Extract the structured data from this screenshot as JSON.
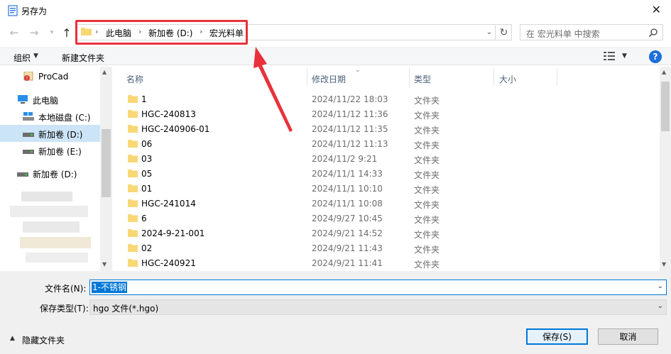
{
  "window": {
    "title": "另存为",
    "close_glyph": "✕"
  },
  "address": {
    "crumbs": [
      "此电脑",
      "新加卷 (D:)",
      "宏光料单"
    ],
    "separator": "›"
  },
  "search": {
    "placeholder": "在 宏光料单 中搜索"
  },
  "toolbar": {
    "organize": "组织",
    "new_folder": "新建文件夹",
    "help": "?"
  },
  "nav_pane": {
    "items": [
      {
        "label": "ProCad",
        "icon": "procad-icon"
      },
      {
        "label": "此电脑",
        "icon": "computer-icon"
      },
      {
        "label": "本地磁盘 (C:)",
        "icon": "drive-c-icon"
      },
      {
        "label": "新加卷 (D:)",
        "icon": "drive-icon",
        "selected": true
      },
      {
        "label": "新加卷 (E:)",
        "icon": "drive-icon"
      },
      {
        "label": "新加卷 (D:)",
        "icon": "network-drive-icon"
      }
    ]
  },
  "columns": {
    "name": "名称",
    "date": "修改日期",
    "type": "类型",
    "size": "大小"
  },
  "files": [
    {
      "name": "1",
      "date": "2024/11/22 18:03",
      "type": "文件夹"
    },
    {
      "name": "HGC-240813",
      "date": "2024/11/12 11:36",
      "type": "文件夹"
    },
    {
      "name": "HGC-240906-01",
      "date": "2024/11/12 11:35",
      "type": "文件夹"
    },
    {
      "name": "06",
      "date": "2024/11/12 11:13",
      "type": "文件夹"
    },
    {
      "name": "03",
      "date": "2024/11/2 9:21",
      "type": "文件夹"
    },
    {
      "name": "05",
      "date": "2024/11/1 14:33",
      "type": "文件夹"
    },
    {
      "name": "01",
      "date": "2024/11/1 10:10",
      "type": "文件夹"
    },
    {
      "name": "HGC-241014",
      "date": "2024/11/1 10:08",
      "type": "文件夹"
    },
    {
      "name": "6",
      "date": "2024/9/27 10:45",
      "type": "文件夹"
    },
    {
      "name": "2024-9-21-001",
      "date": "2024/9/21 14:52",
      "type": "文件夹"
    },
    {
      "name": "02",
      "date": "2024/9/21 11:43",
      "type": "文件夹"
    },
    {
      "name": "HGC-240921",
      "date": "2024/9/21 11:41",
      "type": "文件夹"
    }
  ],
  "filename": {
    "label": "文件名(N):",
    "value": "1-不锈钢"
  },
  "save_type": {
    "label": "保存类型(T):",
    "value": "hgo 文件(*.hgo)"
  },
  "footer": {
    "hide_folders": "隐藏文件夹",
    "save": "保存(S)",
    "cancel": "取消"
  },
  "colors": {
    "accent": "#0078d7",
    "annotation": "#e8323b",
    "folder": "#f8d775",
    "selected_bg": "#cce4f7"
  }
}
